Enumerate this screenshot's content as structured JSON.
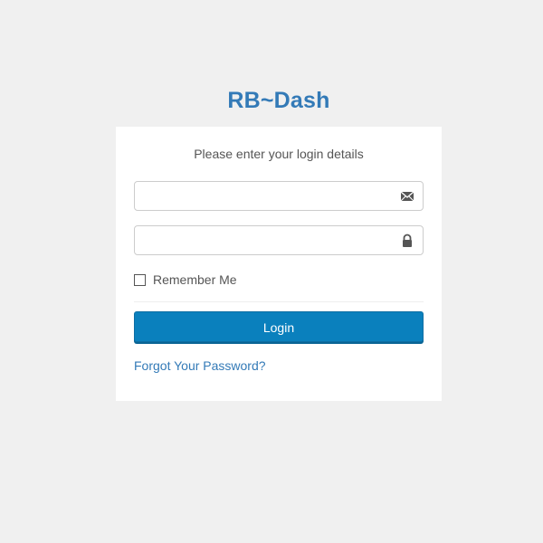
{
  "brand": {
    "title": "RB~Dash"
  },
  "login_card": {
    "heading": "Please enter your login details",
    "email_field": {
      "value": "",
      "placeholder": "",
      "icon": "envelope-icon"
    },
    "password_field": {
      "value": "",
      "placeholder": "",
      "icon": "lock-icon"
    },
    "remember_label": "Remember Me",
    "remember_checked": false,
    "login_label": "Login",
    "forgot_label": "Forgot Your Password?"
  },
  "colors": {
    "background": "#f0f0f0",
    "brand": "#337ab7",
    "primary_button": "#0a80bd",
    "link": "#337ab7"
  }
}
